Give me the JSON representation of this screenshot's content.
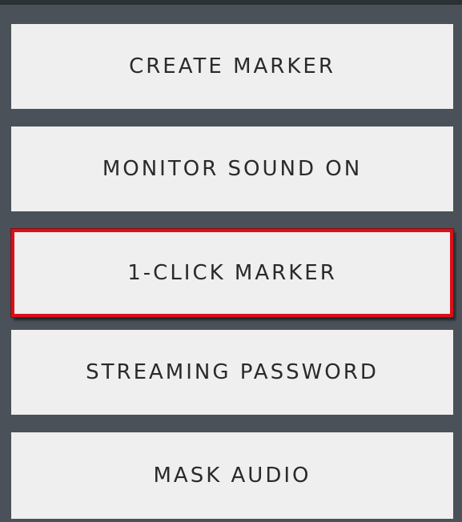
{
  "menu": {
    "items": [
      {
        "label": "CREATE MARKER",
        "highlighted": false
      },
      {
        "label": "MONITOR SOUND ON",
        "highlighted": false
      },
      {
        "label": "1-CLICK MARKER",
        "highlighted": true
      },
      {
        "label": "STREAMING PASSWORD",
        "highlighted": false
      },
      {
        "label": "MASK AUDIO",
        "highlighted": false
      }
    ]
  },
  "colors": {
    "panel_background": "#4a5158",
    "button_background": "#eeefee",
    "button_text": "#2a2a2a",
    "highlight_border": "#d8101a"
  }
}
